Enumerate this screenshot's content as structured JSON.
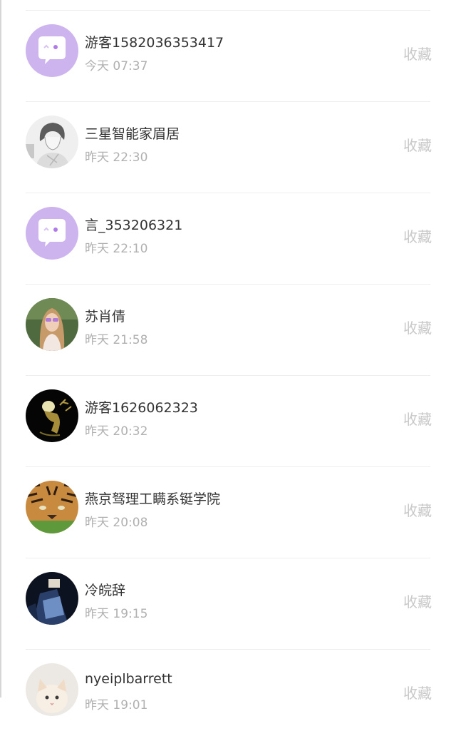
{
  "favorite_label": "收藏",
  "contacts": [
    {
      "name": "游客1582036353417",
      "time": "今天 07:37",
      "avatar": "chat-bubble-icon"
    },
    {
      "name": "三星智能家眉居",
      "time": "昨天 22:30",
      "avatar": "anime-sketch"
    },
    {
      "name": "言_353206321",
      "time": "昨天 22:10",
      "avatar": "chat-bubble-icon"
    },
    {
      "name": "苏肖倩",
      "time": "昨天 21:58",
      "avatar": "woman-photo"
    },
    {
      "name": "游客1626062323",
      "time": "昨天 20:32",
      "avatar": "dark-deer-photo"
    },
    {
      "name": "燕京驽理工瞒系铤学院",
      "time": "昨天 20:08",
      "avatar": "tiger-photo"
    },
    {
      "name": "冷皖辞",
      "time": "昨天 19:15",
      "avatar": "dark-blue-photo"
    },
    {
      "name": "nyeiplbarrett",
      "time": "昨天 19:01",
      "avatar": "kitten-photo"
    }
  ]
}
